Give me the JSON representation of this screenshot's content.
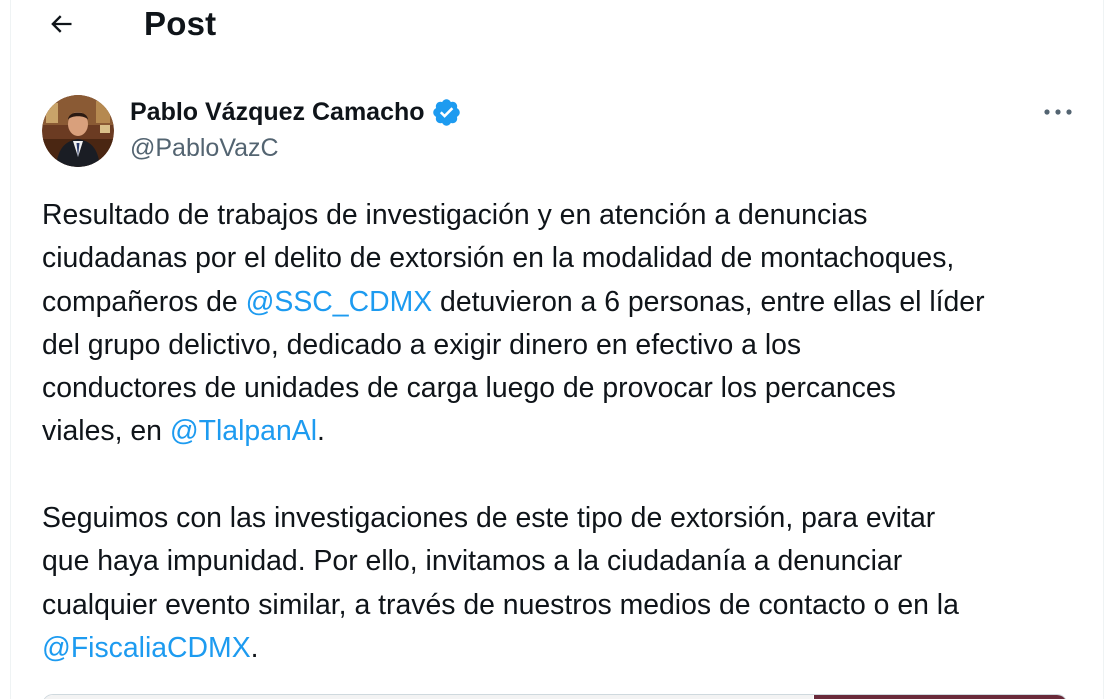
{
  "header": {
    "back_icon": "arrow-left-icon",
    "title": "Post"
  },
  "author": {
    "name": "Pablo Vázquez Camacho",
    "handle": "@PabloVazC",
    "verified_icon": "verified-badge-icon",
    "verified_color": "#1d9bf0"
  },
  "more_icon": "more-horizontal-icon",
  "post": {
    "p1": {
      "l1": "Resultado de trabajos de investigación y en atención a denuncias",
      "l2": "ciudadanas por el delito de extorsión en la modalidad de montachoques,",
      "l3_before": "compañeros de ",
      "l3_mention": "@SSC_CDMX",
      "l3_after": " detuvieron a 6 personas, entre ellas el líder",
      "l4": "del grupo delictivo, dedicado a exigir dinero en efectivo a los",
      "l5": "conductores de unidades de carga luego de provocar los percances",
      "l6_before": "viales, en ",
      "l6_mention": "@TlalpanAl",
      "l6_after": "."
    },
    "p2": {
      "l1": "Seguimos con las investigaciones de este tipo de extorsión, para evitar",
      "l2": "que haya impunidad. Por ello, invitamos a la ciudadanía a denunciar",
      "l3": "cualquier evento similar, a través de nuestros medios de contacto o en la",
      "l4_mention": "@FiscaliaCDMX",
      "l4_after": "."
    }
  },
  "colors": {
    "text": "#0f1419",
    "secondary": "#536471",
    "link": "#1d9bf0",
    "border": "#eff3f4"
  }
}
